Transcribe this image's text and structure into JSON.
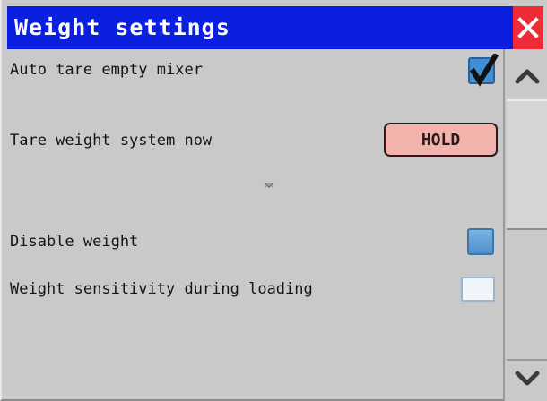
{
  "window": {
    "title": "Weight settings"
  },
  "settings": [
    {
      "label": "Auto tare empty mixer",
      "control": "checkbox",
      "checked": true
    },
    {
      "label": "Tare weight system now",
      "control": "button",
      "button_label": "HOLD"
    },
    {
      "label": "Disable weight",
      "control": "checkbox",
      "checked": false
    },
    {
      "label": "Weight sensitivity during loading",
      "control": "checkbox",
      "checked": false
    }
  ],
  "icons": {
    "close": "close-icon",
    "scroll_up": "chevron-up-icon",
    "scroll_down": "chevron-down-icon",
    "check": "checkmark-icon"
  },
  "colors": {
    "titlebar": "#0a1fe0",
    "close": "#ef2b37",
    "hold_button": "#f2b3ad",
    "background": "#c9c9c9"
  }
}
